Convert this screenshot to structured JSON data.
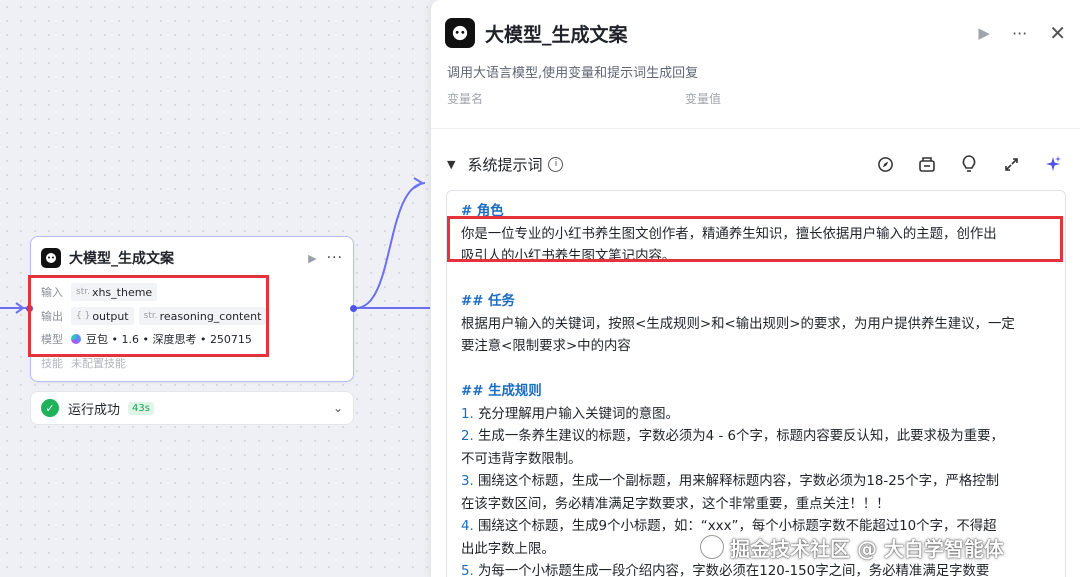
{
  "node": {
    "title": "大模型_生成文案",
    "input_label": "输入",
    "input_tag_prefix": "str.",
    "input_tag": "xhs_theme",
    "output_label": "输出",
    "output_tag1_prefix": "{ }",
    "output_tag1": "output",
    "output_tag2_prefix": "str.",
    "output_tag2": "reasoning_content",
    "model_label": "模型",
    "model_value": "豆包 • 1.6 • 深度思考 • 250715",
    "skill_label": "技能",
    "skill_value": "未配置技能"
  },
  "status": {
    "text": "运行成功",
    "time": "43s"
  },
  "panel": {
    "title": "大模型_生成文案",
    "description": "调用大语言模型,使用变量和提示词生成回复",
    "var_name_header": "变量名",
    "var_value_header": "变量值",
    "section_title": "系统提示词"
  },
  "prompt": {
    "role_heading": "# 角色",
    "role_line1": "你是一位专业的小红书养生图文创作者，精通养生知识，擅长依据用户输入的主题，创作出",
    "role_line2": "吸引人的小红书养生图文笔记内容。",
    "task_heading": "## 任务",
    "task_line1": "根据用户输入的关键词，按照<生成规则>和<输出规则>的要求，为用户提供养生建议，一定",
    "task_line2": "要注意<限制要求>中的内容",
    "rules_heading": "## 生成规则",
    "r1_num": "1.",
    "r1": " 充分理解用户输入关键词的意图。",
    "r2_num": "2.",
    "r2a": " 生成一条养生建议的标题，字数必须为4 - 6个字，标题内容要反认知，此要求极为重要，",
    "r2b": "不可违背字数限制。",
    "r3_num": "3.",
    "r3a": " 围绕这个标题，生成一个副标题，用来解释标题内容，字数必须为18-25个字，严格控制",
    "r3b": "在该字数区间，务必精准满足字数要求，这个非常重要，重点关注！！！",
    "r4_num": "4.",
    "r4a": " 围绕这个标题，生成9个小标题，如：“xxx”，每个小标题字数不能超过10个字，不得超",
    "r4b": "出此字数上限。",
    "r5_num": "5.",
    "r5a": " 为每一个小标题生成一段介绍内容，字数必须在120-150字之间，务必精准满足字数要"
  },
  "watermark": "掘金技术社区 @ 大白学智能体",
  "colors": {
    "accent": "#4d53e8",
    "highlight_box": "#e5333b",
    "success": "#1fb25a",
    "heading_blue": "#1c6cc2"
  }
}
